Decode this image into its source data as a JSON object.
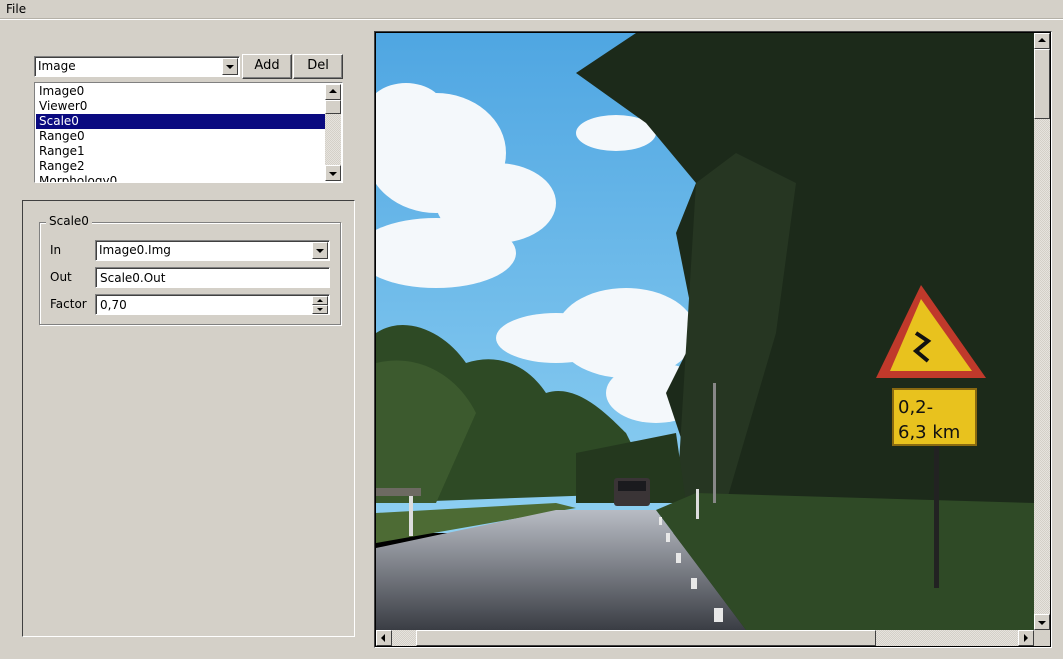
{
  "menubar": {
    "file_label": "File"
  },
  "module_selector": {
    "type_value": "Image",
    "add_label": "Add",
    "del_label": "Del"
  },
  "module_list": {
    "items": [
      "Image0",
      "Viewer0",
      "Scale0",
      "Range0",
      "Range1",
      "Range2",
      "Morphology0"
    ],
    "selected": "Scale0"
  },
  "properties": {
    "group_title": "Scale0",
    "in_label": "In",
    "in_value": "Image0.Img",
    "out_label": "Out",
    "out_value": "Scale0.Out",
    "factor_label": "Factor",
    "factor_value": "0,70"
  },
  "sign": {
    "line1": "0,2-",
    "line2": "6,3 km"
  },
  "colors": {
    "window_bg": "#d4d0c8",
    "selection": "#0a0a80",
    "sky": "#5fb1e6",
    "sign_yellow": "#e8c21e",
    "sign_red": "#c0392b"
  }
}
